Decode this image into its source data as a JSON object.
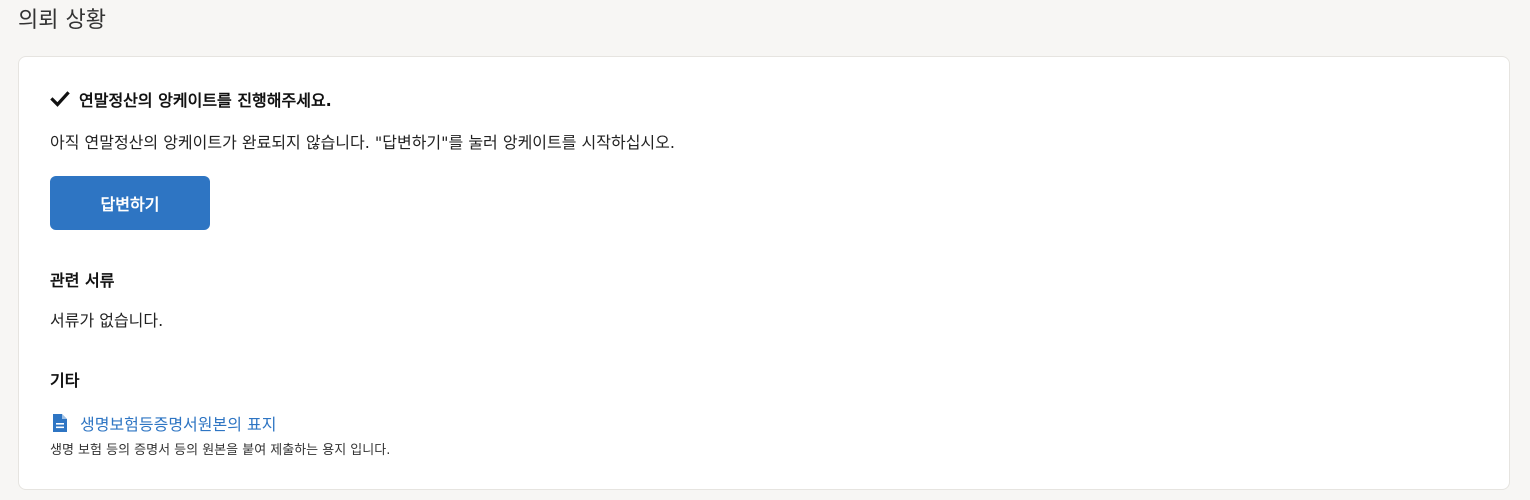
{
  "page": {
    "title": "의뢰 상황"
  },
  "task": {
    "check_icon": "check-icon",
    "title": "연말정산의 앙케이트를 진행해주세요.",
    "description": "아직 연말정산의 앙케이트가 완료되지 않습니다. \"답변하기\"를 눌러 앙케이트를 시작하십시오.",
    "button_label": "답변하기"
  },
  "related_docs": {
    "heading": "관련 서류",
    "empty_text": "서류가 없습니다."
  },
  "other": {
    "heading": "기타",
    "items": [
      {
        "icon": "document-icon",
        "link_text": "생명보험등증명서원본의 표지",
        "description": "생명 보험 등의 증명서 등의 원본을 붙여 제출하는 용지 입니다."
      }
    ]
  },
  "colors": {
    "accent": "#2e75c3",
    "background": "#f7f6f4",
    "card": "#ffffff"
  }
}
